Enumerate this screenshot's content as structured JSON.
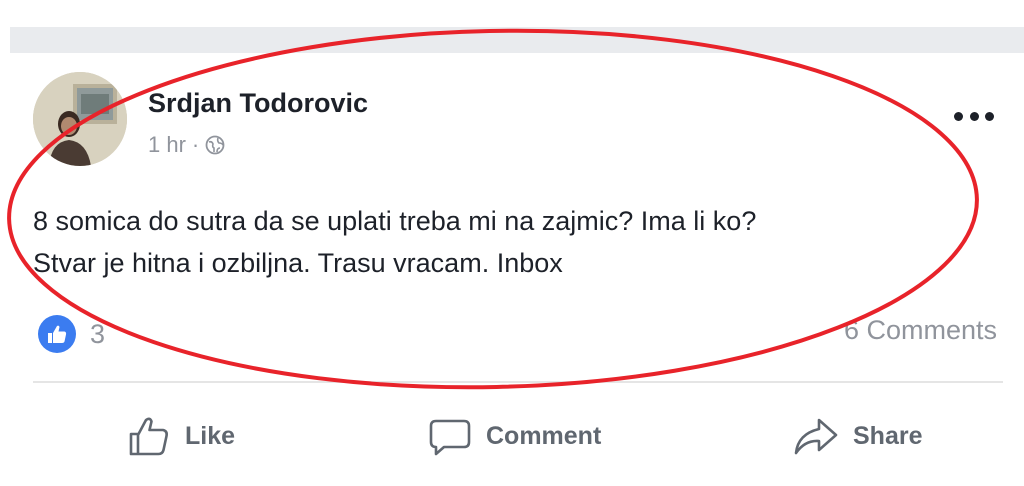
{
  "post": {
    "author": "Srdjan Todorovic",
    "time": "1 hr",
    "separator": "·",
    "privacy_icon": "globe-icon",
    "text_line1": "8 somica do sutra da se uplati treba mi na zajmic? Ima li ko?",
    "text_line2": "Stvar je hitna i ozbiljna. Trasu vracam. Inbox",
    "reaction_icon": "like-reaction-icon",
    "reaction_count": "3",
    "comments_count": "6 Comments",
    "more_icon": "more-options-icon"
  },
  "actions": {
    "like_label": "Like",
    "comment_label": "Comment",
    "share_label": "Share"
  },
  "colors": {
    "background": "#ffffff",
    "top_bar": "#e9ebee",
    "text": "#1d2129",
    "secondary_text": "#90949c",
    "action_text": "#606770",
    "like_blue": "#3b7cf0",
    "annotation_red": "#e8232a"
  }
}
